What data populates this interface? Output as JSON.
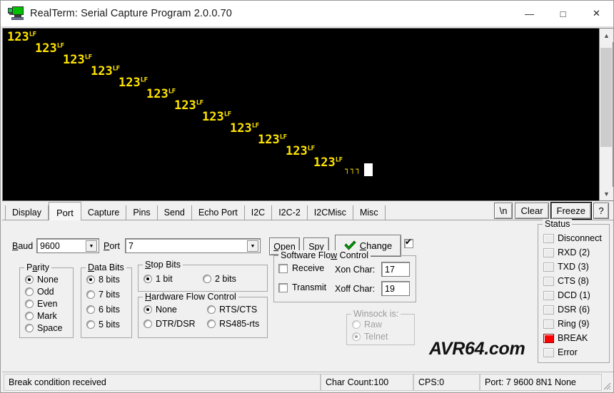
{
  "window": {
    "title": "RealTerm: Serial Capture Program 2.0.0.70",
    "icon": "computer-terminal-icon",
    "minimize": "—",
    "maximize": "□",
    "close": "✕"
  },
  "terminal": {
    "text_color": "#ffe400",
    "background_color": "#000000",
    "lines": [
      {
        "text": "123",
        "control": "LF",
        "indent": 0
      },
      {
        "text": "123",
        "control": "LF",
        "indent": 1
      },
      {
        "text": "123",
        "control": "LF",
        "indent": 2
      },
      {
        "text": "123",
        "control": "LF",
        "indent": 3
      },
      {
        "text": "123",
        "control": "LF",
        "indent": 4
      },
      {
        "text": "123",
        "control": "LF",
        "indent": 5
      },
      {
        "text": "123",
        "control": "LF",
        "indent": 6
      },
      {
        "text": "123",
        "control": "LF",
        "indent": 7
      },
      {
        "text": "123",
        "control": "LF",
        "indent": 8
      },
      {
        "text": "123",
        "control": "LF",
        "indent": 9
      },
      {
        "text": "123",
        "control": "LF",
        "indent": 10
      },
      {
        "text": "123",
        "control": "LF",
        "indent": 11
      }
    ],
    "trailing_garbled": "┐┐┐",
    "cursor": "block",
    "scrollbar": {
      "up": "▲",
      "down": "▼"
    }
  },
  "tabs": [
    {
      "label": "Display",
      "active": false
    },
    {
      "label": "Port",
      "active": true
    },
    {
      "label": "Capture",
      "active": false
    },
    {
      "label": "Pins",
      "active": false
    },
    {
      "label": "Send",
      "active": false
    },
    {
      "label": "Echo Port",
      "active": false
    },
    {
      "label": "I2C",
      "active": false
    },
    {
      "label": "I2C-2",
      "active": false
    },
    {
      "label": "I2CMisc",
      "active": false
    },
    {
      "label": "Misc",
      "active": false
    }
  ],
  "tab_buttons": [
    {
      "label": "\\n",
      "name": "newline-button"
    },
    {
      "label": "Clear",
      "name": "clear-button"
    },
    {
      "label": "Freeze",
      "name": "freeze-button"
    },
    {
      "label": "?",
      "name": "help-button"
    }
  ],
  "port_panel": {
    "baud_label": "Baud",
    "baud_value": "9600",
    "port_label": "Port",
    "port_value": "7",
    "open_button": "Open",
    "spy_button": "Spy",
    "change_button": "Change",
    "change_icon": "green-check-icon",
    "change_checkbox_checked": true,
    "parity": {
      "title": "Parity",
      "options": [
        "None",
        "Odd",
        "Even",
        "Mark",
        "Space"
      ],
      "selected": "None"
    },
    "data_bits": {
      "title": "Data Bits",
      "options": [
        "8 bits",
        "7 bits",
        "6 bits",
        "5 bits"
      ],
      "selected": "8 bits"
    },
    "stop_bits": {
      "title": "Stop Bits",
      "options": [
        "1 bit",
        "2 bits"
      ],
      "selected": "1 bit"
    },
    "hardware_flow": {
      "title": "Hardware Flow Control",
      "options": [
        "None",
        "RTS/CTS",
        "DTR/DSR",
        "RS485-rts"
      ],
      "selected": "None"
    },
    "software_flow": {
      "title": "Software Flow Control",
      "receive_label": "Receive",
      "receive_checked": false,
      "transmit_label": "Transmit",
      "transmit_checked": false,
      "xon_label": "Xon Char:",
      "xon_value": "17",
      "xoff_label": "Xoff Char:",
      "xoff_value": "19"
    },
    "winsock": {
      "title": "Winsock is:",
      "options": [
        "Raw",
        "Telnet"
      ],
      "selected": "Telnet",
      "disabled": true
    }
  },
  "status_panel": {
    "title": "Status",
    "leds": [
      {
        "label": "Disconnect",
        "active": false
      },
      {
        "label": "RXD (2)",
        "active": false
      },
      {
        "label": "TXD (3)",
        "active": false
      },
      {
        "label": "CTS (8)",
        "active": false
      },
      {
        "label": "DCD (1)",
        "active": false
      },
      {
        "label": "DSR (6)",
        "active": false
      },
      {
        "label": "Ring (9)",
        "active": false
      },
      {
        "label": "BREAK",
        "active": true
      },
      {
        "label": "Error",
        "active": false
      }
    ],
    "active_color": "#ff0000"
  },
  "watermark": "AVR64.com",
  "statusbar": {
    "message": "Break condition received",
    "char_count": "Char Count:100",
    "cps": "CPS:0",
    "port_info": "Port: 7 9600 8N1 None"
  }
}
